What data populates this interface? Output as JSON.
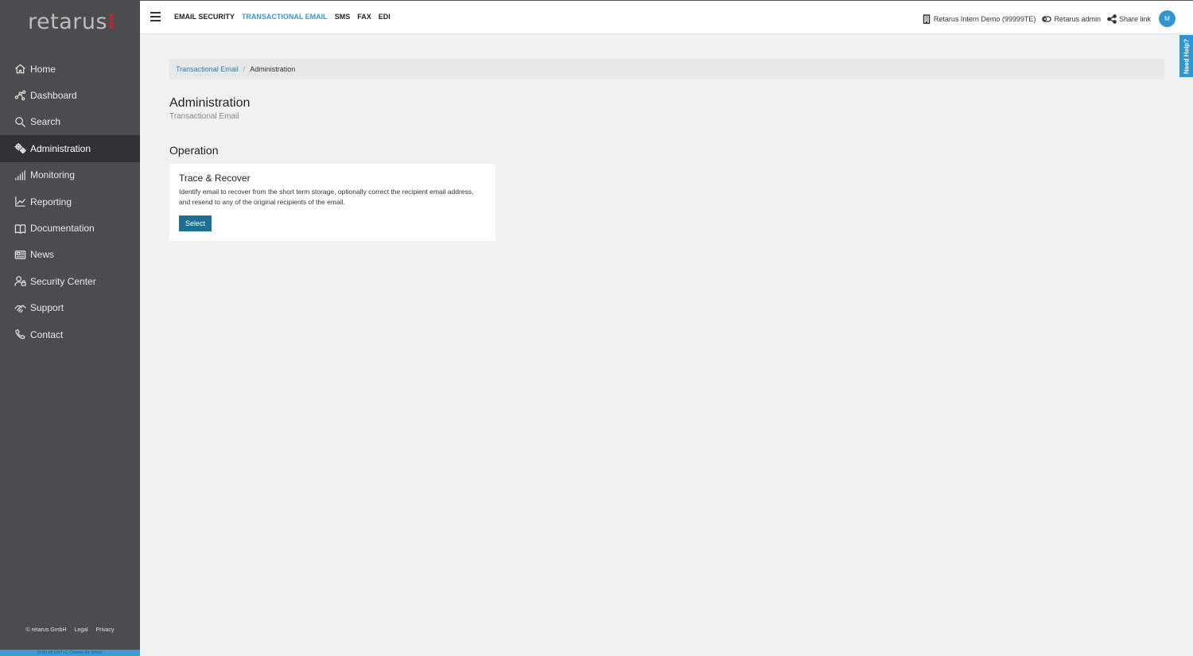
{
  "brand": {
    "logo_text": "retarus",
    "logo_dots": "⁞"
  },
  "sidebar": {
    "items": [
      {
        "label": "Home",
        "icon": "home-icon"
      },
      {
        "label": "Dashboard",
        "icon": "dashboard-icon"
      },
      {
        "label": "Search",
        "icon": "search-icon"
      },
      {
        "label": "Administration",
        "icon": "gears-icon",
        "active": true
      },
      {
        "label": "Monitoring",
        "icon": "signal-bars-icon"
      },
      {
        "label": "Reporting",
        "icon": "chart-icon"
      },
      {
        "label": "Documentation",
        "icon": "book-icon"
      },
      {
        "label": "News",
        "icon": "newspaper-icon"
      },
      {
        "label": "Security Center",
        "icon": "user-lock-icon"
      },
      {
        "label": "Support",
        "icon": "handshake-icon"
      },
      {
        "label": "Contact",
        "icon": "phone-icon"
      }
    ],
    "footer": {
      "company": "© retarus GmbH",
      "legal": "Legal",
      "privacy": "Privacy"
    },
    "bottom_bar_text": "01:41:09 GMT+2, Chrome 84, Win32"
  },
  "topbar": {
    "nav": [
      {
        "label": "EMAIL SECURITY",
        "active": false
      },
      {
        "label": "TRANSACTIONAL EMAIL",
        "active": true
      },
      {
        "label": "SMS",
        "active": false
      },
      {
        "label": "FAX",
        "active": false
      },
      {
        "label": "EDI",
        "active": false
      }
    ],
    "account": "Retarus Intern Demo (99999TE)",
    "user": "Retarus admin",
    "share": "Share link",
    "avatar_initial": "M"
  },
  "need_help": "Need Help?",
  "breadcrumb": {
    "parent": "Transactional Email",
    "current": "Administration"
  },
  "page": {
    "title": "Administration",
    "subtitle": "Transactional Email"
  },
  "section": {
    "title": "Operation",
    "card": {
      "title": "Trace & Recover",
      "description": "Identify email to recover from the short term storage, optionally correct the recipient email address, and resend to any of the original recipients of the email.",
      "button": "Select"
    }
  },
  "colors": {
    "accent": "#2f96cf",
    "sidebar_bg": "#4a4c50",
    "sidebar_active": "#303236",
    "button": "#1f6f94",
    "logo_dots": "#c0272d"
  }
}
